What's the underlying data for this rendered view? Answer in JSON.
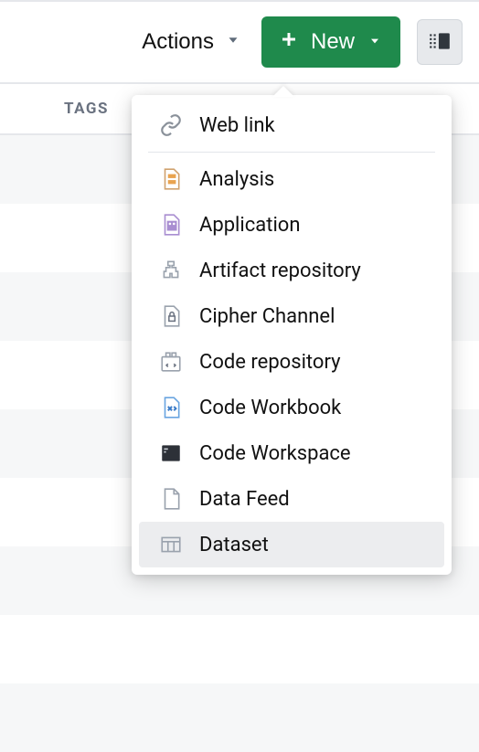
{
  "toolbar": {
    "actions_label": "Actions",
    "new_label": "New"
  },
  "header": {
    "tags_label": "TAGS"
  },
  "dropdown": {
    "web_link": "Web link",
    "items": [
      {
        "label": "Analysis"
      },
      {
        "label": "Application"
      },
      {
        "label": "Artifact repository"
      },
      {
        "label": "Cipher Channel"
      },
      {
        "label": "Code repository"
      },
      {
        "label": "Code Workbook"
      },
      {
        "label": "Code Workspace"
      },
      {
        "label": "Data Feed"
      },
      {
        "label": "Dataset"
      }
    ]
  }
}
